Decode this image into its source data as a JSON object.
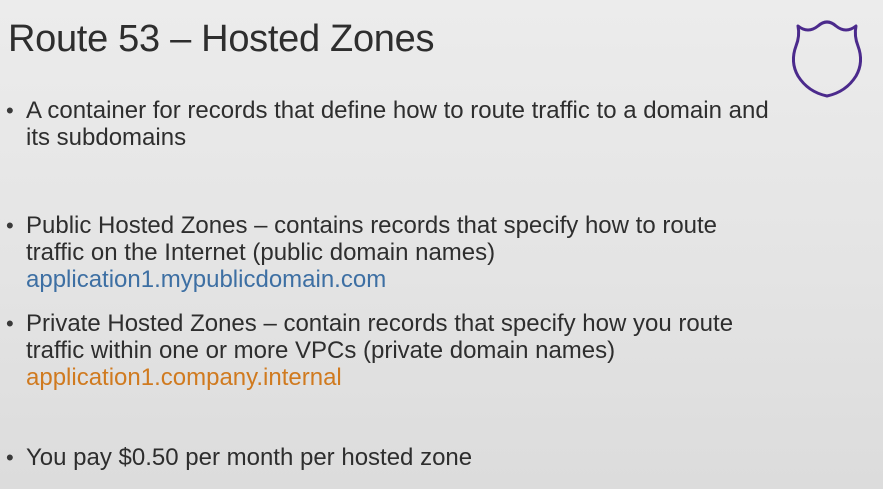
{
  "slide": {
    "title": "Route 53 – Hosted Zones",
    "icon": "route-shield-icon",
    "colors": {
      "shield_stroke": "#4b2a8c",
      "blue_link": "#3d6fa3",
      "orange_link": "#d07a1f",
      "text": "#2e2e2e"
    },
    "bullets": [
      {
        "line1": "A container for records that define how to route traffic to a domain and",
        "line2": "its subdomains"
      },
      {
        "line1": "Public Hosted Zones – contains records that specify how to route",
        "line2": "traffic on the Internet (public domain names)",
        "example": "application1.mypublicdomain.com"
      },
      {
        "line1": "Private Hosted Zones – contain records that specify how you route",
        "line2": "traffic within one or more VPCs (private domain names)",
        "example": "application1.company.internal"
      },
      {
        "line1": "You pay $0.50 per month per hosted zone"
      }
    ]
  }
}
